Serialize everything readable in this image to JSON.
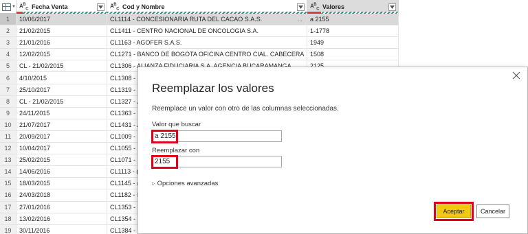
{
  "columns": [
    {
      "type_icon": "ABC",
      "name": "Fecha Venta"
    },
    {
      "type_icon": "ABC",
      "name": "Cod y Nombre"
    },
    {
      "type_icon": "ABC",
      "name": "Valores"
    }
  ],
  "rows": [
    {
      "n": "1",
      "fecha": "10/06/2017",
      "cod": "CL1114 - CONCESIONARIA RUTA DEL CACAO S.A.S.",
      "ell": "...",
      "valor": "a 2155"
    },
    {
      "n": "2",
      "fecha": "21/02/2015",
      "cod": "CL1411 - CENTRO NACIONAL DE ONCOLOGIA S.A.",
      "ell": "",
      "valor": "1-1778"
    },
    {
      "n": "3",
      "fecha": "21/01/2016",
      "cod": "CL1163 - AGOFER S.A.S.",
      "ell": "",
      "valor": "1949"
    },
    {
      "n": "4",
      "fecha": "12/02/2015",
      "cod": "CL1271 - BANCO DE BOGOTA OFICINA CENTRO CIAL. CABECERA",
      "ell": "",
      "valor": "1508"
    },
    {
      "n": "5",
      "fecha": "CL - 21/02/2015",
      "cod": "CL1306 - ALIANZA FIDUCIARIA S.A. AGENCIA BUCARAMANGA",
      "ell": "",
      "valor": "2125"
    },
    {
      "n": "6",
      "fecha": "4/10/2015",
      "cod": "CL1308 - (",
      "ell": "",
      "valor": ""
    },
    {
      "n": "7",
      "fecha": "25/10/2017",
      "cod": "CL1319 - (",
      "ell": "",
      "valor": ""
    },
    {
      "n": "8",
      "fecha": "CL - 21/02/2015",
      "cod": "CL1327 - A",
      "ell": "",
      "valor": ""
    },
    {
      "n": "9",
      "fecha": "24/11/2015",
      "cod": "CL1363 - I",
      "ell": "",
      "valor": ""
    },
    {
      "n": "10",
      "fecha": "21/07/2017",
      "cod": "CL1431 - A",
      "ell": "",
      "valor": ""
    },
    {
      "n": "11",
      "fecha": "20/09/2017",
      "cod": "CL1009 - I",
      "ell": "",
      "valor": ""
    },
    {
      "n": "12",
      "fecha": "10/04/2017",
      "cod": "CL1055 - I",
      "ell": "",
      "valor": ""
    },
    {
      "n": "13",
      "fecha": "25/02/2015",
      "cod": "CL1071 - (",
      "ell": "",
      "valor": ""
    },
    {
      "n": "14",
      "fecha": "14/06/2016",
      "cod": "CL1113 - (",
      "ell": "",
      "valor": ""
    },
    {
      "n": "15",
      "fecha": "18/03/2015",
      "cod": "CL1145 - (",
      "ell": "",
      "valor": ""
    },
    {
      "n": "16",
      "fecha": "24/03/2018",
      "cod": "CL1182 - I",
      "ell": "",
      "valor": ""
    },
    {
      "n": "17",
      "fecha": "27/01/2016",
      "cod": "CL1353 - I",
      "ell": "",
      "valor": ""
    },
    {
      "n": "18",
      "fecha": "13/02/2016",
      "cod": "CL1354 - I",
      "ell": "",
      "valor": ""
    },
    {
      "n": "19",
      "fecha": "30/11/2016",
      "cod": "CL1384 - I",
      "ell": "",
      "valor": ""
    }
  ],
  "dialog": {
    "title": "Reemplazar los valores",
    "description": "Reemplace un valor con otro de las columnas seleccionadas.",
    "find_label": "Valor que buscar",
    "find_value": "a 2155",
    "replace_label": "Reemplazar con",
    "replace_value": "2155",
    "advanced_label": "Opciones avanzadas",
    "ok_label": "Aceptar",
    "cancel_label": "Cancelar"
  },
  "colors": {
    "accent_yellow": "#f2c811",
    "highlight_red": "#e0001b",
    "selected_row": "#d9d9d9"
  },
  "icons": [
    "table-icon",
    "text-type-icon",
    "dropdown-icon",
    "close-icon",
    "expand-triangle-icon"
  ]
}
